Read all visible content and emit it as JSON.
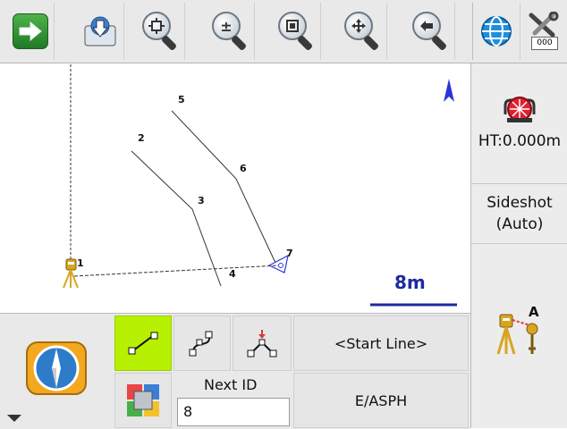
{
  "toolbar": {
    "buttons": [
      {
        "name": "next-arrow-icon"
      },
      {
        "name": "download-icon"
      },
      {
        "name": "zoom-window-icon"
      },
      {
        "name": "zoom-in-out-icon"
      },
      {
        "name": "zoom-extents-icon"
      },
      {
        "name": "pan-icon"
      },
      {
        "name": "previous-view-icon"
      },
      {
        "name": "globe-icon"
      },
      {
        "name": "settings-tools-icon"
      }
    ],
    "settings_badge": "000"
  },
  "map": {
    "labels": [
      "1",
      "2",
      "3",
      "4",
      "5",
      "6",
      "7"
    ],
    "north_label": "north-arrow",
    "scale": "8m"
  },
  "right_panel": {
    "height_label": "HT:0.000m",
    "mode_line1": "Sideshot",
    "mode_line2": "(Auto)",
    "station_icon_letter": "A"
  },
  "bottom": {
    "start_line": "<Start Line>",
    "next_id_label": "Next ID",
    "next_id_value": "8",
    "code": "E/ASPH"
  },
  "colors": {
    "accent_green": "#b7f000",
    "scale_blue": "#1d2aa0",
    "toolbar_bg": "#e9e9e9"
  }
}
